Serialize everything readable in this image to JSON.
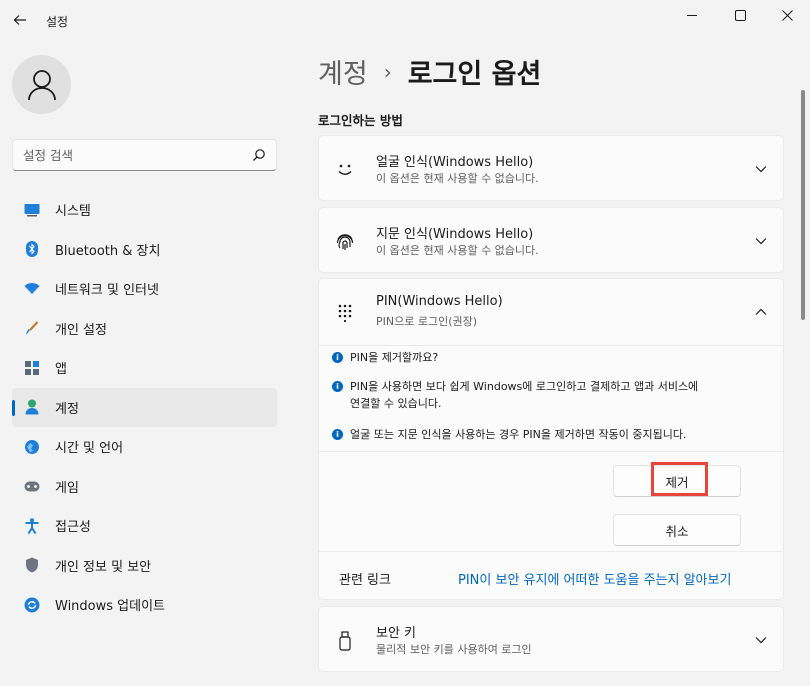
{
  "window": {
    "title": "설정",
    "controls": [
      "minimize-icon",
      "maximize-icon",
      "close-icon"
    ]
  },
  "sidebar": {
    "search_placeholder": "설정 검색",
    "items": [
      {
        "label": "시스템",
        "icon": "system-icon"
      },
      {
        "label": "Bluetooth & 장치",
        "icon": "bluetooth-icon"
      },
      {
        "label": "네트워크 및 인터넷",
        "icon": "network-icon"
      },
      {
        "label": "개인 설정",
        "icon": "brush-icon"
      },
      {
        "label": "앱",
        "icon": "apps-icon"
      },
      {
        "label": "계정",
        "icon": "account-icon",
        "active": true
      },
      {
        "label": "시간 및 언어",
        "icon": "globe-icon"
      },
      {
        "label": "게임",
        "icon": "gamepad-icon"
      },
      {
        "label": "접근성",
        "icon": "accessibility-icon"
      },
      {
        "label": "개인 정보 및 보안",
        "icon": "shield-icon"
      },
      {
        "label": "Windows 업데이트",
        "icon": "update-icon"
      }
    ]
  },
  "main": {
    "breadcrumb": {
      "parent": "계정",
      "separator": "›",
      "current": "로그인 옵션"
    },
    "section_title": "로그인하는 방법",
    "face": {
      "title": "얼굴 인식(Windows Hello)",
      "subtitle": "이 옵션은 현재 사용할 수 없습니다."
    },
    "fingerprint": {
      "title": "지문 인식(Windows Hello)",
      "subtitle": "이 옵션은 현재 사용할 수 없습니다."
    },
    "pin": {
      "title": "PIN(Windows Hello)",
      "subtitle": "PIN으로 로그인(권장)",
      "info": [
        "PIN을 제거할까요?",
        "PIN을 사용하면 보다 쉽게 Windows에 로그인하고 결제하고 앱과 서비스에",
        "연결할 수 있습니다.",
        "얼굴 또는 지문 인식을 사용하는 경우 PIN을 제거하면 작동이 중지됩니다."
      ],
      "remove_label": "제거",
      "cancel_label": "취소",
      "related_label": "관련 링크",
      "related_link": "PIN이 보안 유지에 어떠한 도움을 주는지 알아보기"
    },
    "security_key": {
      "title": "보안 키",
      "subtitle": "물리적 보안 키를 사용하여 로그인"
    }
  },
  "colors": {
    "accent": "#0067c0",
    "highlight": "#e8443a"
  }
}
